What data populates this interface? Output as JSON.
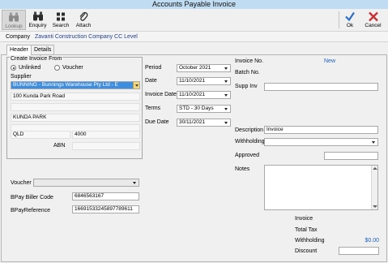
{
  "window": {
    "title": "Accounts Payable Invoice"
  },
  "toolbar": {
    "lookup": "Lookup",
    "enquiry": "Enquiry",
    "search": "Search",
    "attach": "Attach",
    "ok": "Ok",
    "cancel": "Cancel"
  },
  "company": {
    "label": "Company",
    "value": "Zavanti Construction Company CC Level"
  },
  "tabs": [
    "Header",
    "Details"
  ],
  "create_invoice": {
    "title": "Create Invoice From",
    "options": [
      "Unlinked",
      "Voucher"
    ],
    "selected": "Unlinked"
  },
  "supplier": {
    "label": "Supplier",
    "value": "BUNNING - Bunnings Warehouse Pty Ltd - E",
    "address1": "100 Kunda Park Road",
    "address2": "",
    "suburb": "KUNDA PARK",
    "address4": "",
    "state": "QLD",
    "postcode": "4000",
    "abn_label": "ABN",
    "abn": ""
  },
  "dates": {
    "period_label": "Period",
    "period": "October 2021",
    "date_label": "Date",
    "date": "11/10/2021",
    "invoice_date_label": "Invoice Date",
    "invoice_date": "11/10/2021",
    "terms_label": "Terms",
    "terms": "STD - 30 Days",
    "due_date_label": "Due Date",
    "due_date": "30/11/2021"
  },
  "invoice": {
    "invoice_no_label": "Invoice No.",
    "invoice_no": "New",
    "batch_no_label": "Batch No.",
    "supp_inv_label": "Supp Inv",
    "supp_inv": "",
    "description_label": "Description",
    "description": "Invoice",
    "withholding_label": "Withholding",
    "withholding": "",
    "approved_label": "Approved",
    "approved": "",
    "notes_label": "Notes",
    "notes": ""
  },
  "payment": {
    "voucher_label": "Voucher",
    "voucher": "",
    "bpay_biller_label": "BPay Biller Code",
    "bpay_biller": "6846563167",
    "bpay_ref_label": "BPayReference",
    "bpay_ref": "16691533245897789611"
  },
  "totals": {
    "invoice_label": "Invoice",
    "total_tax_label": "Total Tax",
    "withholding_label": "Withholding",
    "withholding_value": "$0.00",
    "discount_label": "Discount",
    "discount_value": ""
  },
  "colors": {
    "title_bar": "#bfdcf2",
    "selection": "#3d8ee0",
    "link_blue": "#1f5fbf",
    "ok_check": "#2a6fc4",
    "cancel_x": "#c83232"
  }
}
